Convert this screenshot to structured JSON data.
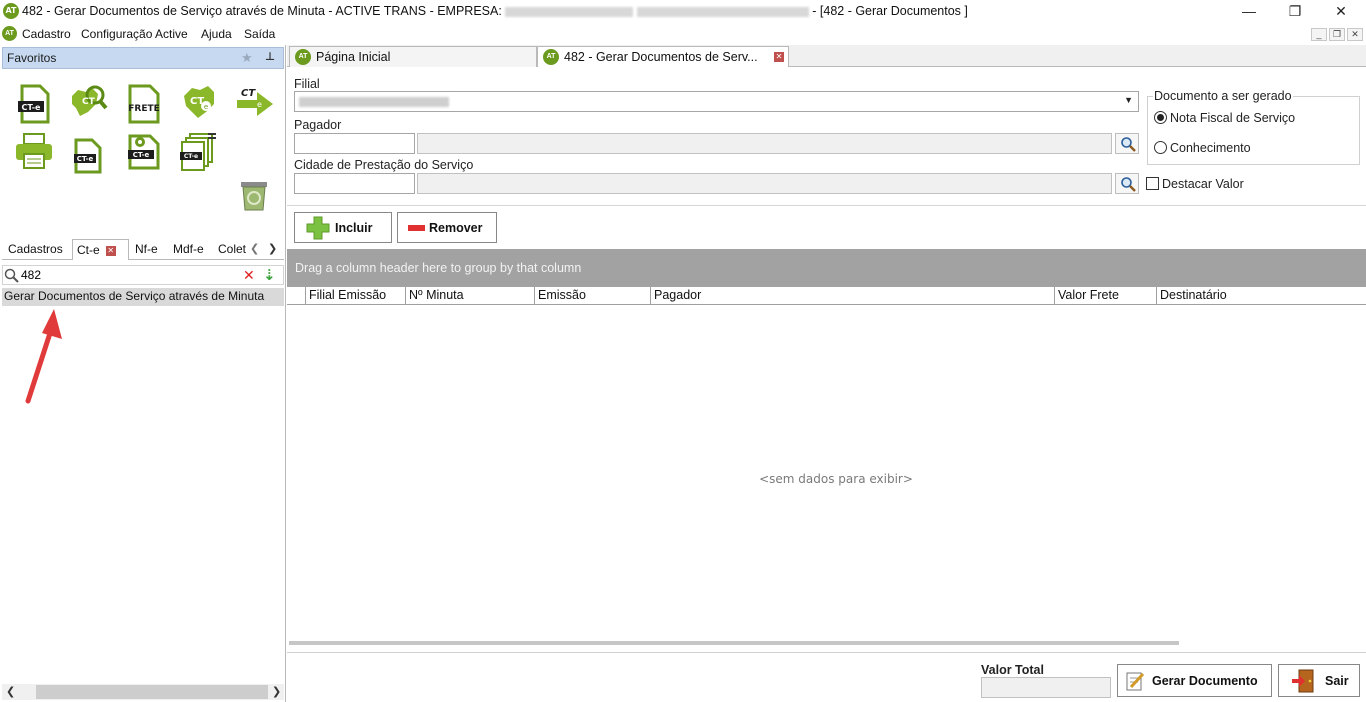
{
  "window": {
    "title_prefix": "482 - Gerar Documentos de Serviço através de Minuta - ACTIVE TRANS - EMPRESA:",
    "title_suffix": "- [482 - Gerar Documentos ]",
    "logo": "AT"
  },
  "menu": {
    "items": [
      "Cadastro",
      "Configuração Active",
      "Ajuda",
      "Saída"
    ]
  },
  "favorites": {
    "header": "Favoritos",
    "icons": [
      {
        "name": "cte-document-icon",
        "label": "CT-e"
      },
      {
        "name": "cte-search-icon",
        "label": "CT e"
      },
      {
        "name": "frete-document-icon",
        "label": "FRETE"
      },
      {
        "name": "cte-map-icon",
        "label": "CT e"
      },
      {
        "name": "cte-send-icon",
        "label": "CT e"
      },
      {
        "name": "printer-icon",
        "label": ""
      },
      {
        "name": "cte-small-doc-icon",
        "label": "CT-e"
      },
      {
        "name": "cte-settings-doc-icon",
        "label": "CT-e"
      },
      {
        "name": "cte-stack-icon",
        "label": "CT-e"
      },
      {
        "name": "recycle-bin-icon",
        "label": ""
      }
    ]
  },
  "left_tabs": [
    "Cadastros",
    "Ct-e",
    "Nf-e",
    "Mdf-e",
    "Colet"
  ],
  "left_search": {
    "value": "482"
  },
  "left_result": "Gerar Documentos de Serviço através de Minuta",
  "doc_tabs": [
    {
      "label": "Página Inicial"
    },
    {
      "label": "482 - Gerar Documentos de Serv..."
    }
  ],
  "form": {
    "filial_label": "Filial",
    "pagador_label": "Pagador",
    "cidade_label": "Cidade de Prestação do Serviço",
    "doc_group_label": "Documento a ser gerado",
    "radio_nf": "Nota Fiscal de Serviço",
    "radio_conh": "Conhecimento",
    "destacar_label": "Destacar Valor",
    "btn_incluir": "Incluir",
    "btn_remover": "Remover"
  },
  "grid": {
    "group_hint": "Drag a column header here to group by that column",
    "columns": [
      "Filial Emissão",
      "Nº Minuta",
      "Emissão",
      "Pagador",
      "Valor Frete",
      "Destinatário"
    ],
    "empty_text": "<sem dados para exibir>"
  },
  "footer": {
    "valor_total_label": "Valor Total",
    "btn_gerar": "Gerar Documento",
    "btn_sair": "Sair"
  },
  "colors": {
    "brand_green": "#6b9a1e",
    "fav_header": "#c6d9f1",
    "group_panel": "#a2a2a2",
    "remove_red": "#e03030",
    "add_green": "#7cc242"
  }
}
